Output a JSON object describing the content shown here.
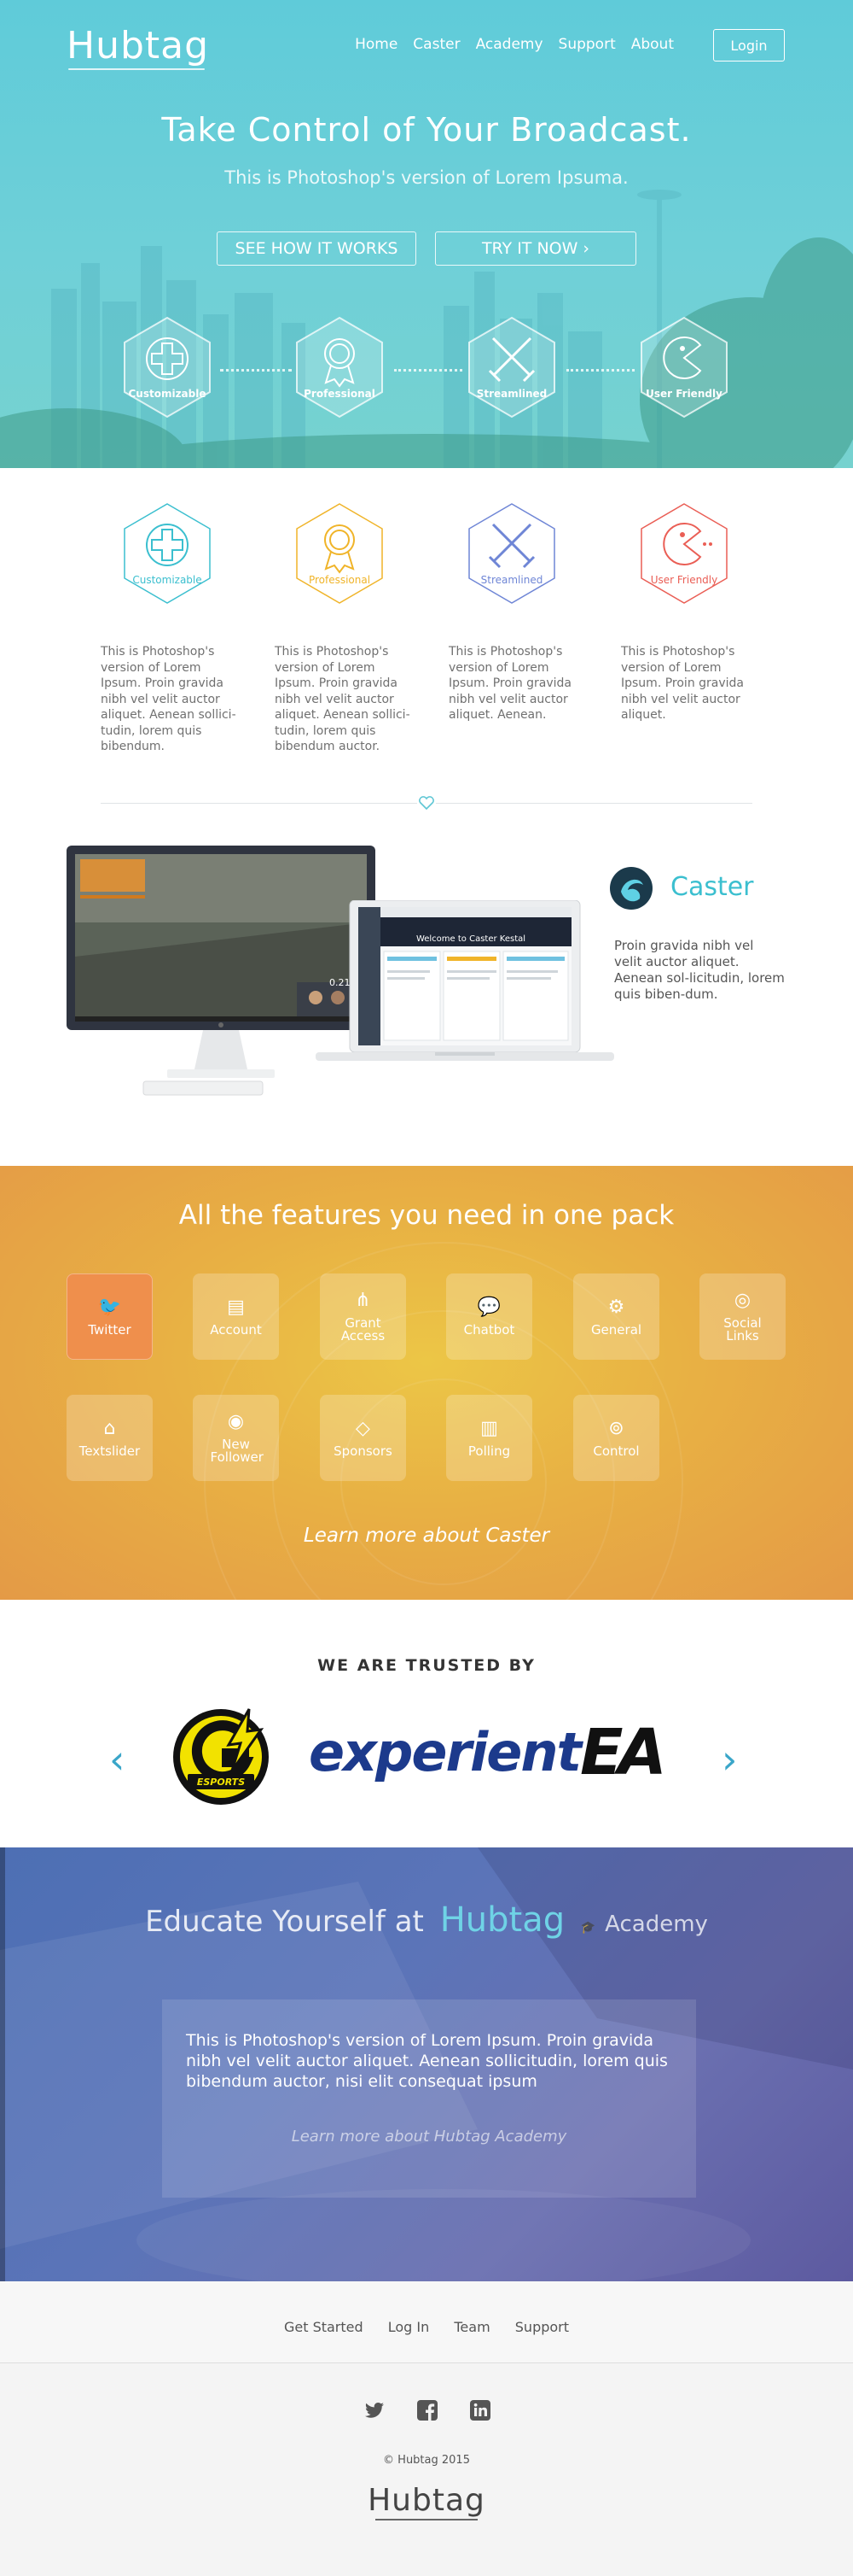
{
  "header": {
    "logo": "Hubtag",
    "nav": [
      "Home",
      "Caster",
      "Academy",
      "Support",
      "About"
    ],
    "login": "Login"
  },
  "hero": {
    "title": "Take Control of Your Broadcast.",
    "subtitle": "This is Photoshop's version  of Lorem Ipsuma.",
    "btn_how": "SEE HOW IT WORKS",
    "btn_try": "TRY IT NOW ›",
    "badges": [
      "Customizable",
      "Professional",
      "Streamlined",
      "User Friendly"
    ]
  },
  "features": {
    "badges": [
      "Customizable",
      "Professional",
      "Streamlined",
      "User Friendly"
    ],
    "descriptions": [
      "This is Photoshop's version  of Lorem Ipsum. Proin gravida nibh vel velit auctor aliquet. Aenean sollici-tudin, lorem quis bibendum.",
      "This is Photoshop's version  of Lorem Ipsum. Proin gravida nibh vel velit auctor aliquet. Aenean sollici-tudin, lorem quis bibendum auctor.",
      "This is Photoshop's version  of Lorem Ipsum. Proin gravida nibh vel velit auctor aliquet. Aenean.",
      "This is Photoshop's version  of Lorem Ipsum. Proin gravida nibh vel velit auctor aliquet."
    ],
    "colors": [
      "#3bbfcf",
      "#f0b429",
      "#6f86d6",
      "#ea5e55"
    ]
  },
  "caster": {
    "name": "Caster",
    "description": "Proin gravida nibh vel velit auctor aliquet. Aenean sol-licitudin, lorem quis biben-dum.",
    "laptop_welcome": "Welcome to Caster Kestal",
    "game_overlay": "0.21"
  },
  "pack": {
    "title": "All the features you need in one pack",
    "tiles": [
      {
        "label": "Twitter",
        "icon": "twitter-icon",
        "glyph": "🐦"
      },
      {
        "label": "Account",
        "icon": "account-icon",
        "glyph": "▤"
      },
      {
        "label": "Grant Access",
        "icon": "share-icon",
        "glyph": "⋔"
      },
      {
        "label": "Chatbot",
        "icon": "chat-icon",
        "glyph": "💬"
      },
      {
        "label": "General",
        "icon": "gear-icon",
        "glyph": "⚙"
      },
      {
        "label": "Social Links",
        "icon": "globe-icon",
        "glyph": "◎"
      },
      {
        "label": "Textslider",
        "icon": "tag-icon",
        "glyph": "⌂"
      },
      {
        "label": "New Follower",
        "icon": "eye-icon",
        "glyph": "◉"
      },
      {
        "label": "Sponsors",
        "icon": "diamond-icon",
        "glyph": "◇"
      },
      {
        "label": "Polling",
        "icon": "bar-chart-icon",
        "glyph": "▥"
      },
      {
        "label": "Control",
        "icon": "gamepad-icon",
        "glyph": "⊚"
      }
    ],
    "link": "Learn more about Caster"
  },
  "trusted": {
    "title": "WE ARE TRUSTED BY",
    "logos": [
      "ESPORTS",
      "experient",
      "EA"
    ]
  },
  "academy": {
    "title_prefix": "Educate Yourself at",
    "brand": "Hubtag",
    "brand_suffix": "Academy",
    "text": "This is Photoshop's version  of Lorem Ipsum. Proin gravida nibh vel velit auctor aliquet. Aenean sollicitudin, lorem quis bibendum auctor, nisi elit consequat ipsum",
    "link": "Learn more about Hubtag Academy"
  },
  "footer": {
    "links": [
      "Get Started",
      "Log In",
      "Team",
      "Support"
    ],
    "copyright": "© Hubtag 2015",
    "logo": "Hubtag"
  }
}
